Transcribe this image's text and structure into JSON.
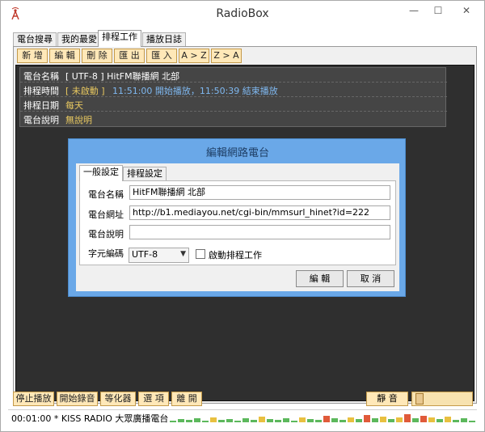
{
  "window": {
    "title": "RadioBox"
  },
  "tabs": [
    {
      "label": "電台搜尋"
    },
    {
      "label": "我的最愛"
    },
    {
      "label": "排程工作"
    },
    {
      "label": "播放日誌"
    }
  ],
  "toolbar": [
    {
      "label": "新 增"
    },
    {
      "label": "編 輯"
    },
    {
      "label": "刪 除"
    },
    {
      "label": "匯 出"
    },
    {
      "label": "匯 入"
    },
    {
      "label": "A > Z"
    },
    {
      "label": "Z > A"
    }
  ],
  "schedule": {
    "name_label": "電台名稱",
    "name_value": "[ UTF-8 ] HitFM聯播網 北部",
    "time_label": "排程時間",
    "time_status": "[ 未啟動 ]",
    "time_value": "11:51:00 開始播放，11:50:39 結束播放",
    "date_label": "排程日期",
    "date_value": "每天",
    "desc_label": "電台說明",
    "desc_value": "無說明"
  },
  "dialog": {
    "title": "編輯網路電台",
    "tabs": [
      {
        "label": "一般設定"
      },
      {
        "label": "排程設定"
      }
    ],
    "name_label": "電台名稱",
    "name_value": "HitFM聯播網 北部",
    "url_label": "電台網址",
    "url_value": "http://b1.mediayou.net/cgi-bin/mmsurl_hinet?id=222",
    "desc_label": "電台說明",
    "desc_value": "",
    "encoding_label": "字元編碼",
    "encoding_value": "UTF-8",
    "schedule_checkbox_label": "啟動排程工作",
    "edit_button": "編 輯",
    "cancel_button": "取 消"
  },
  "bottom": [
    {
      "label": "停止播放"
    },
    {
      "label": "開始錄音"
    },
    {
      "label": "等化器"
    },
    {
      "label": "選 項"
    },
    {
      "label": "離 開"
    }
  ],
  "mute_label": "靜 音",
  "status": {
    "text": "00:01:00 * KISS RADIO 大眾廣播電台"
  },
  "colors": {
    "accent_blue": "#6aa8e8",
    "button_orange": "#ffe8b8",
    "dark_panel": "#2f2f2f",
    "time_blue": "#7fb8f0",
    "yellow_text": "#e8c860"
  },
  "icons": {
    "app": "radio-tower-icon"
  }
}
